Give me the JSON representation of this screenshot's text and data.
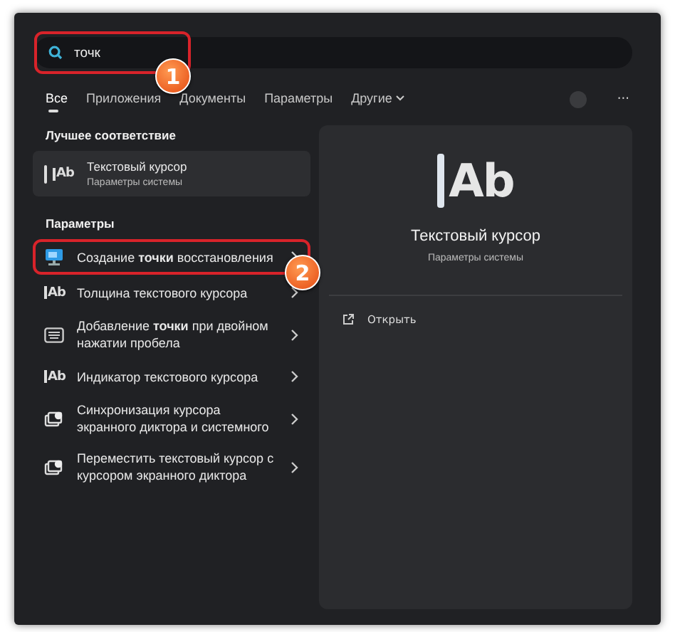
{
  "search": {
    "value": "точк"
  },
  "tabs": [
    {
      "label": "Все",
      "selected": true
    },
    {
      "label": "Приложения",
      "selected": false
    },
    {
      "label": "Документы",
      "selected": false
    },
    {
      "label": "Параметры",
      "selected": false
    },
    {
      "label": "Другие",
      "selected": false,
      "dropdown": true
    }
  ],
  "more_button": "···",
  "best_match": {
    "heading": "Лучшее соответствие",
    "item": {
      "kind": "cursor",
      "glyph": "Ab",
      "title": "Текстовый курсор",
      "subtitle": "Параметры системы",
      "selected": true
    }
  },
  "settings": {
    "heading": "Параметры",
    "items": [
      {
        "kind": "restore",
        "title": "Создание **точки** восстановления",
        "selected": false
      },
      {
        "kind": "cursor",
        "glyph": "Ab",
        "title": "Толщина текстового курсора",
        "selected": false
      },
      {
        "kind": "keyboard",
        "title": "Добавление **точки** при двойном нажатии пробела",
        "selected": false
      },
      {
        "kind": "cursor",
        "glyph": "Ab",
        "title": "Индикатор текстового курсора",
        "selected": false
      },
      {
        "kind": "narrator",
        "title": "Синхронизация курсора экранного диктора и системного",
        "selected": false
      },
      {
        "kind": "narrator",
        "title": "Переместить текстовый курсор с курсором экранного диктора",
        "selected": false
      }
    ]
  },
  "preview": {
    "glyph": "Ab",
    "title": "Текстовый курсор",
    "subtitle": "Параметры системы",
    "actions": [
      {
        "label": "Открыть"
      }
    ]
  },
  "annotations": [
    {
      "number": "1"
    },
    {
      "number": "2"
    }
  ]
}
